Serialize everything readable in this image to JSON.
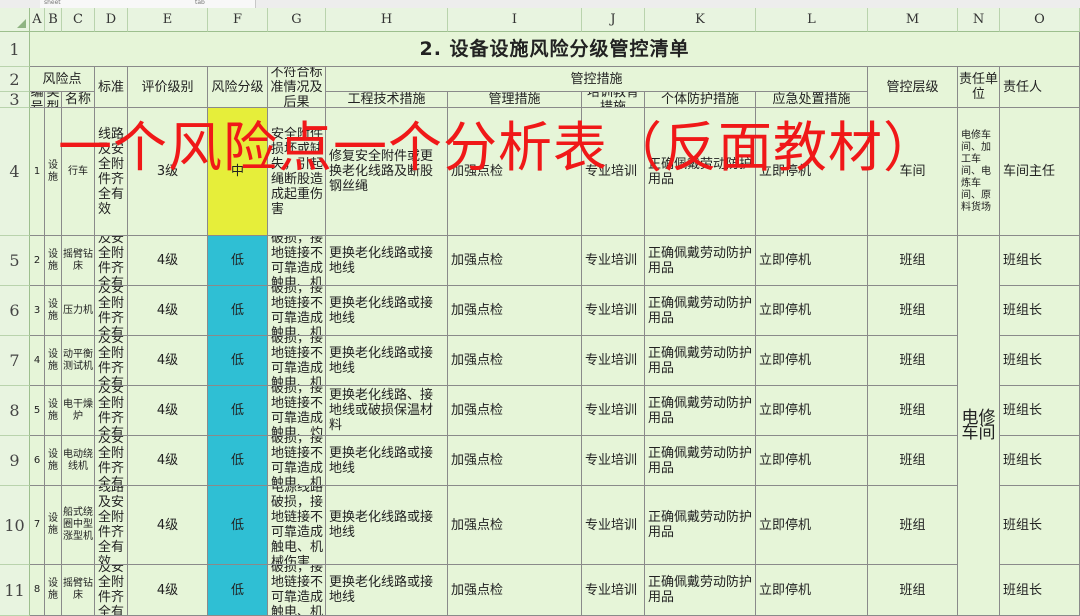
{
  "tab_bar": {
    "tabs": [
      "sheet",
      "tab"
    ]
  },
  "column_headers": [
    "A",
    "B",
    "C",
    "D",
    "E",
    "F",
    "G",
    "H",
    "I",
    "J",
    "K",
    "L",
    "M",
    "N",
    "O"
  ],
  "row_headers": [
    "1",
    "2",
    "3",
    "4",
    "5",
    "6",
    "7",
    "8",
    "9",
    "10",
    "11"
  ],
  "title": "2. 设备设施风险分级管控清单",
  "headers": {
    "risk_point": "风险点",
    "standard": "标准",
    "eval_level": "评价级别",
    "risk_grade": "风险分级",
    "nonconformity": "不符合标准情况及后果",
    "control_measures": "管控措施",
    "control_level": "管控层级",
    "responsible_unit": "责任单位",
    "responsible_person": "责任人",
    "number": "编号",
    "type": "类型",
    "name": "名称",
    "engineering": "工程技术措施",
    "management": "管理措施",
    "training": "培训教育措施",
    "ppe": "个体防护措施",
    "emergency": "应急处置措施"
  },
  "rows": [
    {
      "number": "1",
      "type": "设施",
      "name": "行车",
      "standard": "线路及安全附件齐全有效",
      "eval": "3级",
      "grade": "中",
      "nonconformity": "安全附件损坏或缺失，引起绳断股造成起重伤害",
      "engineering": "修复安全附件或更换老化线路及断股钢丝绳",
      "management": "加强点检",
      "training": "专业培训",
      "ppe": "正确佩戴劳动防护用品",
      "emergency": "立即停机",
      "level": "车间",
      "unit_note": "电修车间、加工车间、电炼车间、原料货场",
      "person": "车间主任"
    },
    {
      "number": "2",
      "type": "设施",
      "name": "摇臂钻床",
      "standard": "线路及安全附件齐全有效",
      "eval": "4级",
      "grade": "低",
      "nonconformity": "电源线路破损，接地链接不可靠造成触电、机械伤害",
      "engineering": "更换老化线路或接地线",
      "management": "加强点检",
      "training": "专业培训",
      "ppe": "正确佩戴劳动防护用品",
      "emergency": "立即停机",
      "level": "班组",
      "person": "班组长"
    },
    {
      "number": "3",
      "type": "设施",
      "name": "压力机",
      "standard": "线路及安全附件齐全有效",
      "eval": "4级",
      "grade": "低",
      "nonconformity": "电源线路破损，接地链接不可靠造成触电、机械伤害",
      "engineering": "更换老化线路或接地线",
      "management": "加强点检",
      "training": "专业培训",
      "ppe": "正确佩戴劳动防护用品",
      "emergency": "立即停机",
      "level": "班组",
      "person": "班组长"
    },
    {
      "number": "4",
      "type": "设施",
      "name": "动平衡测试机",
      "standard": "线路及安全附件齐全有效",
      "eval": "4级",
      "grade": "低",
      "nonconformity": "电源线路破损，接地链接不可靠造成触电、机械伤害",
      "engineering": "更换老化线路或接地线",
      "management": "加强点检",
      "training": "专业培训",
      "ppe": "正确佩戴劳动防护用品",
      "emergency": "立即停机",
      "level": "班组",
      "person": "班组长"
    },
    {
      "number": "5",
      "type": "设施",
      "name": "电干燥炉",
      "standard": "线路及安全附件齐全有效",
      "eval": "4级",
      "grade": "低",
      "nonconformity": "电源线路破损，接地链接不可靠造成触电、灼烫",
      "engineering": "更换老化线路、接地线或破损保温材料",
      "management": "加强点检",
      "training": "专业培训",
      "ppe": "正确佩戴劳动防护用品",
      "emergency": "立即停机",
      "level": "班组",
      "person": "班组长"
    },
    {
      "number": "6",
      "type": "设施",
      "name": "电动绕线机",
      "standard": "线路及安全附件齐全有效",
      "eval": "4级",
      "grade": "低",
      "nonconformity": "电源线路破损，接地链接不可靠造成触电、机械伤害",
      "engineering": "更换老化线路或接地线",
      "management": "加强点检",
      "training": "专业培训",
      "ppe": "正确佩戴劳动防护用品",
      "emergency": "立即停机",
      "level": "班组",
      "person": "班组长"
    },
    {
      "number": "7",
      "type": "设施",
      "name": "船式绕圈中型涨型机",
      "standard": "线路及安全附件齐全有效",
      "eval": "4级",
      "grade": "低",
      "nonconformity": "电源线路破损，接地链接不可靠造成触电、机械伤害",
      "engineering": "更换老化线路或接地线",
      "management": "加强点检",
      "training": "专业培训",
      "ppe": "正确佩戴劳动防护用品",
      "emergency": "立即停机",
      "level": "班组",
      "person": "班组长"
    },
    {
      "number": "8",
      "type": "设施",
      "name": "摇臂钻床",
      "standard": "线路及安全附件齐全有效",
      "eval": "4级",
      "grade": "低",
      "nonconformity": "电源线路破损，接地链接不可靠造成触电、机械伤害",
      "engineering": "更换老化线路或接地线",
      "management": "加强点检",
      "training": "专业培训",
      "ppe": "正确佩戴劳动防护用品",
      "emergency": "立即停机",
      "level": "班组",
      "person": "班组长"
    }
  ],
  "merged_unit": "电修车间",
  "overlay_caption": "一个风险点一个分析表（反面教材）",
  "colors": {
    "grade_mid": "#e6ee3a",
    "grade_low": "#2fbfd4",
    "caption": "#f01818",
    "sheet_bg": "#e6f5d8"
  }
}
